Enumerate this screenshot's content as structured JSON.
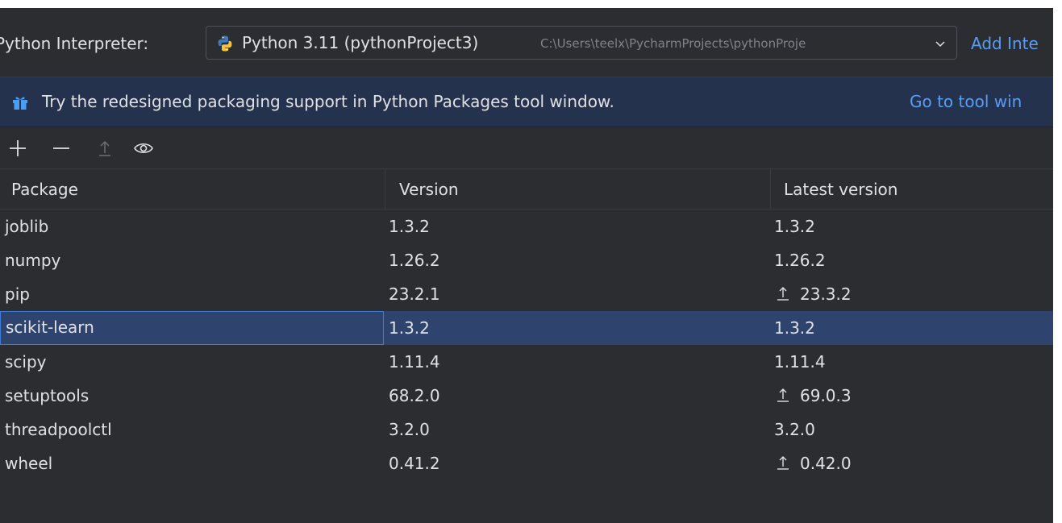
{
  "interpreter": {
    "label": "Python Interpreter:",
    "selected_name": "Python 3.11 (pythonProject3)",
    "selected_path": "C:\\Users\\teelx\\PycharmProjects\\pythonProje",
    "add_link": "Add Inte"
  },
  "banner": {
    "message": "Try the redesigned packaging support in Python Packages tool window.",
    "link": "Go to tool win"
  },
  "toolbar": {
    "buttons": [
      "add-icon",
      "remove-icon",
      "upgrade-icon",
      "eye-icon"
    ]
  },
  "table": {
    "columns": [
      "Package",
      "Version",
      "Latest version"
    ],
    "rows": [
      {
        "package": "joblib",
        "version": "1.3.2",
        "latest": "1.3.2",
        "upgrade": false
      },
      {
        "package": "numpy",
        "version": "1.26.2",
        "latest": "1.26.2",
        "upgrade": false
      },
      {
        "package": "pip",
        "version": "23.2.1",
        "latest": "23.3.2",
        "upgrade": true
      },
      {
        "package": "scikit-learn",
        "version": "1.3.2",
        "latest": "1.3.2",
        "upgrade": false,
        "selected": true
      },
      {
        "package": "scipy",
        "version": "1.11.4",
        "latest": "1.11.4",
        "upgrade": false
      },
      {
        "package": "setuptools",
        "version": "68.2.0",
        "latest": "69.0.3",
        "upgrade": true
      },
      {
        "package": "threadpoolctl",
        "version": "3.2.0",
        "latest": "3.2.0",
        "upgrade": false
      },
      {
        "package": "wheel",
        "version": "0.41.2",
        "latest": "0.42.0",
        "upgrade": true
      }
    ]
  },
  "colors": {
    "background": "#2b2d30",
    "banner": "#25324d",
    "link": "#589df6",
    "selection": "#2e436e",
    "focus_border": "#3d7dd6"
  }
}
